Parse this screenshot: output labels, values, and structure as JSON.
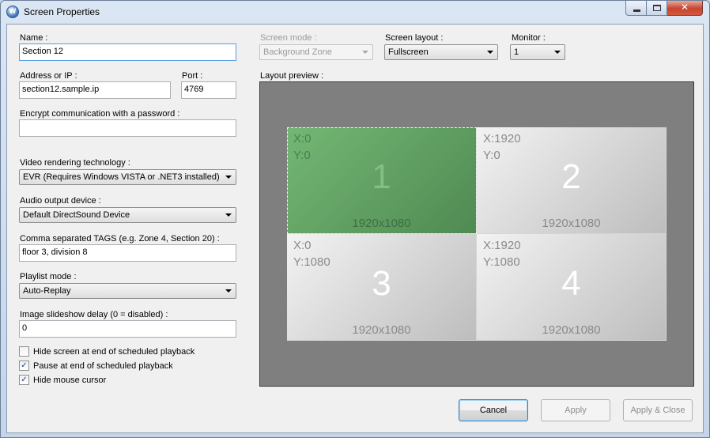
{
  "window": {
    "title": "Screen Properties",
    "app_icon_text": "W"
  },
  "form": {
    "name_label": "Name :",
    "name_value": "Section 12",
    "address_label": "Address or IP :",
    "address_value": "section12.sample.ip",
    "port_label": "Port :",
    "port_value": "4769",
    "encrypt_label": "Encrypt communication with a password :",
    "encrypt_value": "",
    "video_label": "Video rendering technology :",
    "video_value": "EVR (Requires Windows VISTA or .NET3 installed)",
    "audio_label": "Audio output device :",
    "audio_value": "Default DirectSound Device",
    "tags_label": "Comma separated TAGS (e.g. Zone 4, Section 20) :",
    "tags_value": "floor 3, division 8",
    "playlist_label": "Playlist mode :",
    "playlist_value": "Auto-Replay",
    "slideshow_label": "Image slideshow delay (0 = disabled) :",
    "slideshow_value": "0"
  },
  "checkboxes": [
    {
      "label": "Hide screen at end of scheduled playback",
      "checked": false,
      "mark": ""
    },
    {
      "label": "Pause at end of scheduled playback",
      "checked": true,
      "mark": "✓"
    },
    {
      "label": "Hide mouse cursor",
      "checked": true,
      "mark": "✓"
    }
  ],
  "top_controls": {
    "screen_mode_label": "Screen mode :",
    "screen_mode_value": "Background Zone",
    "screen_layout_label": "Screen layout :",
    "screen_layout_value": "Fullscreen",
    "monitor_label": "Monitor :",
    "monitor_value": "1"
  },
  "preview": {
    "label": "Layout preview :",
    "tiles": [
      {
        "x": "X:0",
        "y": "Y:0",
        "num": "1",
        "res": "1920x1080",
        "selected": true
      },
      {
        "x": "X:1920",
        "y": "Y:0",
        "num": "2",
        "res": "1920x1080",
        "selected": false
      },
      {
        "x": "X:0",
        "y": "Y:1080",
        "num": "3",
        "res": "1920x1080",
        "selected": false
      },
      {
        "x": "X:1920",
        "y": "Y:1080",
        "num": "4",
        "res": "1920x1080",
        "selected": false
      }
    ]
  },
  "buttons": {
    "cancel": "Cancel",
    "apply": "Apply",
    "apply_close": "Apply & Close"
  },
  "colors": {
    "selected_tile": "#5f9e62",
    "preview_bg": "#7f7f7f",
    "close_button": "#c5442f"
  }
}
